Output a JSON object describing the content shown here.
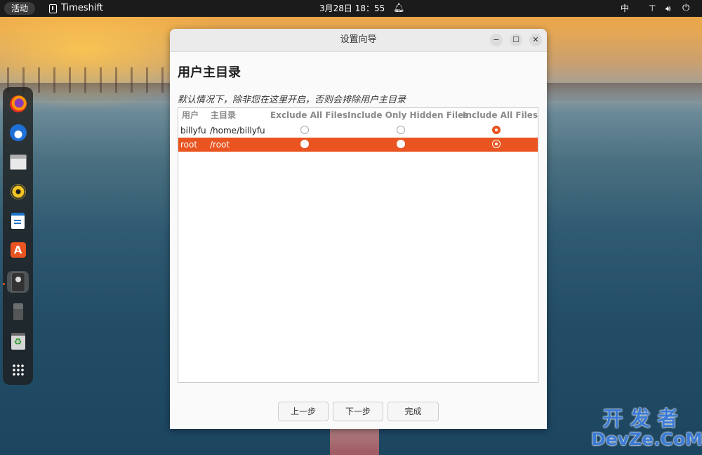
{
  "topbar": {
    "activities": "活动",
    "app_name": "Timeshift",
    "clock": "3月28日 18：55",
    "input_method": "中"
  },
  "dock": {
    "items": [
      "firefox-icon",
      "thunderbird-icon",
      "files-icon",
      "rhythmbox-icon",
      "libreoffice-writer-icon",
      "app-center-icon",
      "timeshift-icon",
      "usb-drive-icon",
      "trash-icon",
      "show-apps-icon"
    ]
  },
  "dialog": {
    "title": "设置向导",
    "heading": "用户主目录",
    "description": "默认情况下，除非您在这里开启，否则会排除用户主目录",
    "columns": [
      "用户",
      "主目录",
      "Exclude All Files",
      "Include Only Hidden Files",
      "Include All Files"
    ],
    "rows": [
      {
        "user": "billyfu",
        "home": "/home/billyfu",
        "selection": "Include All Files",
        "selected": false
      },
      {
        "user": "root",
        "home": "/root",
        "selection": "Include All Files",
        "selected": true
      }
    ],
    "buttons": {
      "prev": "上一步",
      "next": "下一步",
      "finish": "完成"
    }
  },
  "watermark": {
    "line1": "开发者",
    "line2": "DevZe.CoM"
  },
  "colors": {
    "accent": "#e95420",
    "topbar": "#1b1b1b",
    "dialog_bg": "#fafafa"
  }
}
